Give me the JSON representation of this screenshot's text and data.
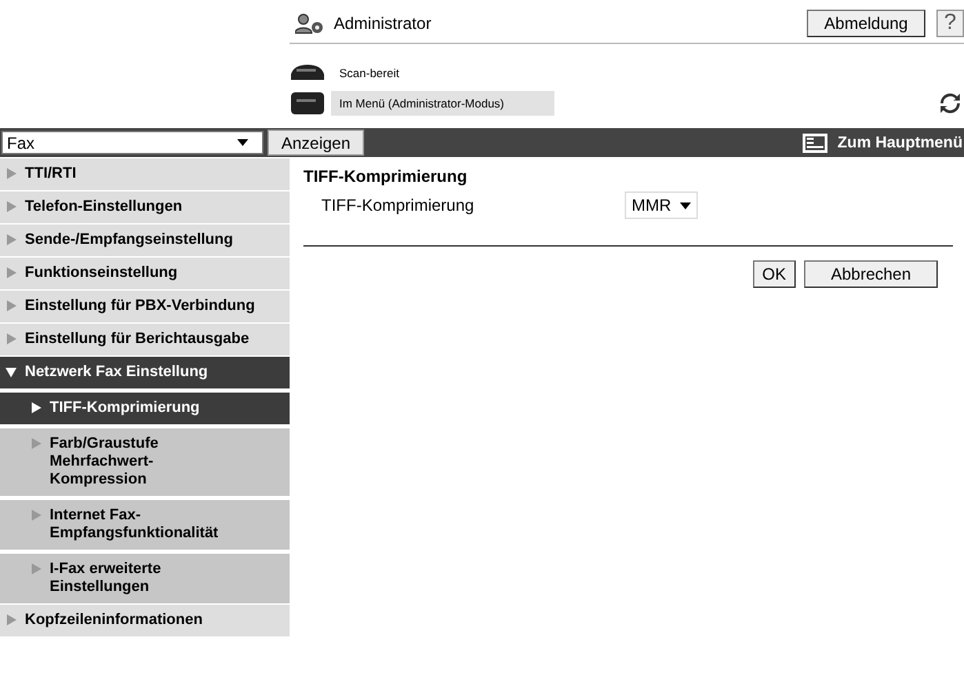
{
  "header": {
    "user": "Administrator",
    "logout_button": "Abmeldung",
    "help": "?"
  },
  "status": [
    {
      "kind": "ready",
      "text": "Scan-bereit",
      "selected": false
    },
    {
      "kind": "menu",
      "text": "Im Menü (Administrator-Modus)",
      "selected": true
    }
  ],
  "toolbar": {
    "category_select": "Fax",
    "show_button": "Anzeigen",
    "main_menu_link": "Zum Hauptmenü"
  },
  "sidebar": {
    "items": [
      {
        "label": "TTI/RTI",
        "selected": false,
        "expanded": false
      },
      {
        "label": "Telefon-Einstellungen",
        "selected": false,
        "expanded": false
      },
      {
        "label": "Sende-/Empfangseinstellung",
        "selected": false,
        "expanded": false
      },
      {
        "label": "Funktionseinstellung",
        "selected": false,
        "expanded": false
      },
      {
        "label": "Einstellung für PBX-Verbindung",
        "selected": false,
        "expanded": false
      },
      {
        "label": "Einstellung für Berichtausgabe",
        "selected": false,
        "expanded": false
      },
      {
        "label": "Netzwerk Fax Einstellung",
        "selected": false,
        "expanded": true,
        "children": [
          {
            "label": "TIFF-Komprimierung",
            "selected": true
          },
          {
            "label": "Farb/Graustufe Mehrfachwert-Kompression",
            "selected": false
          },
          {
            "label": "Internet Fax-Empfangsfunktionalität",
            "selected": false
          },
          {
            "label": "I-Fax erweiterte Einstellungen",
            "selected": false
          }
        ]
      },
      {
        "label": "Kopfzeileninformationen",
        "selected": false,
        "expanded": false
      }
    ]
  },
  "content": {
    "title": "TIFF-Komprimierung",
    "fields": [
      {
        "label": "TIFF-Komprimierung",
        "value": "MMR"
      }
    ],
    "buttons": [
      "OK",
      "Abbrechen"
    ]
  }
}
